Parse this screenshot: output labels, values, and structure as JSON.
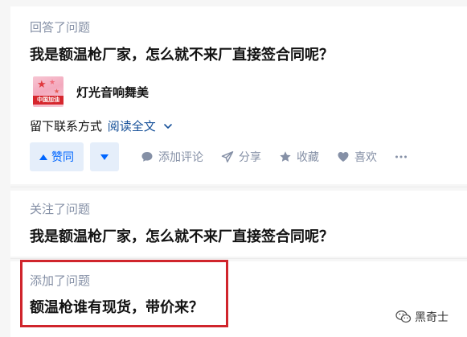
{
  "feed": {
    "items": [
      {
        "activity": "回答了问题",
        "question_title": "我是额温枪厂家，怎么就不来厂直接签合同呢？",
        "author": {
          "name": "灯光音响舞美",
          "avatar_text": "中国加油"
        },
        "excerpt": "留下联系方式",
        "read_more": "阅读全文",
        "actions": {
          "vote_up": "赞同",
          "comment": "添加评论",
          "share": "分享",
          "favorite": "收藏",
          "like": "喜欢"
        }
      },
      {
        "activity": "关注了问题",
        "question_title": "我是额温枪厂家，怎么就不来厂直接签合同呢？"
      },
      {
        "activity": "添加了问题",
        "question_title": "额温枪谁有现货，带价来？"
      }
    ]
  },
  "highlight_color": "#d0252c",
  "accent_color": "#0066ff",
  "watermark": {
    "text": "黑奇士",
    "icon": "wechat-icon"
  }
}
